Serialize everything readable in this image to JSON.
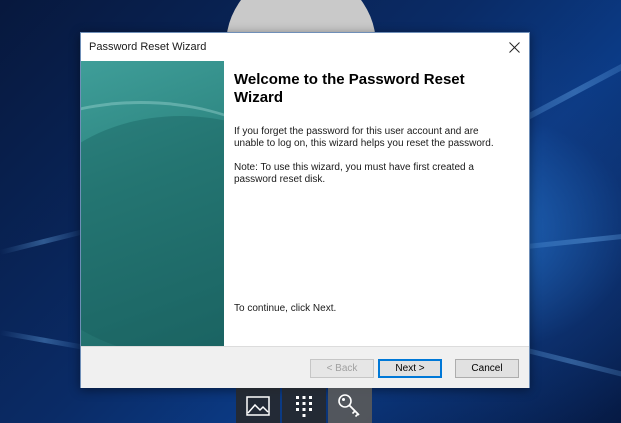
{
  "window": {
    "title": "Password Reset Wizard"
  },
  "wizard": {
    "heading": "Welcome to the Password Reset Wizard",
    "paragraph1": "If you forget the password for this user account and are unable to log on, this wizard helps you reset the password.",
    "paragraph2": "Note: To use this wizard, you must have first created a password reset disk.",
    "continue_text": "To continue, click Next."
  },
  "buttons": {
    "back": "< Back",
    "next": "Next >",
    "cancel": "Cancel"
  },
  "taskbar": {
    "icons": [
      "picture-icon",
      "keypad-icon",
      "key-icon"
    ]
  },
  "colors": {
    "side_panel": "#2d8580",
    "accent": "#0078d7"
  }
}
